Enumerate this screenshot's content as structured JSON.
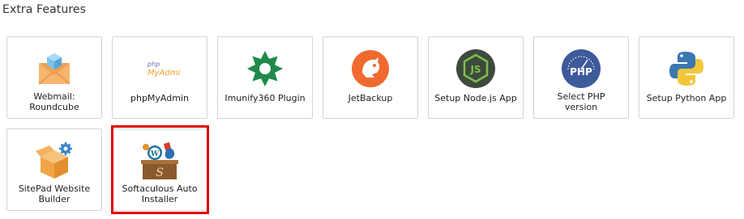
{
  "section": {
    "title": "Extra Features"
  },
  "tiles": [
    {
      "label": "Webmail:\nRoundcube",
      "icon": "envelope-icon"
    },
    {
      "label": "phpMyAdmin",
      "icon": "phpmyadmin-icon",
      "logo_text_top": "php",
      "logo_text_bottom": "MyAdmin"
    },
    {
      "label": "Imunify360 Plugin",
      "icon": "imunify-icon"
    },
    {
      "label": "JetBackup",
      "icon": "jetbackup-icon"
    },
    {
      "label": "Setup Node.js App",
      "icon": "nodejs-icon",
      "logo_text": "JS"
    },
    {
      "label": "Select PHP\nversion",
      "icon": "php-icon",
      "logo_text": "PHP"
    },
    {
      "label": "Setup Python App",
      "icon": "python-icon"
    },
    {
      "label": "SitePad Website\nBuilder",
      "icon": "sitepad-icon"
    },
    {
      "label": "Softaculous Auto\nInstaller",
      "icon": "softaculous-icon",
      "highlighted": true
    }
  ],
  "colors": {
    "highlight": "#e00000",
    "php": "#3d5a9a",
    "node": "#3e4a3b",
    "jetbackup": "#f06a2f",
    "imunify": "#1f8a4a"
  }
}
